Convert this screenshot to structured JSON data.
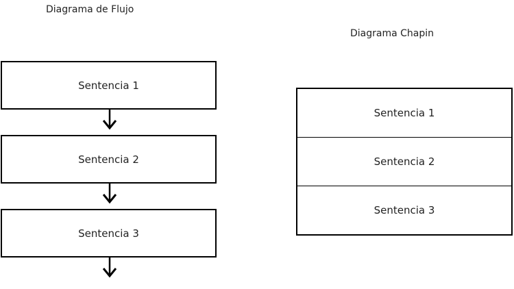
{
  "flow_diagram": {
    "title": "Diagrama de Flujo",
    "steps": [
      "Sentencia 1",
      "Sentencia 2",
      "Sentencia 3"
    ]
  },
  "chapin_diagram": {
    "title": "Diagrama Chapin",
    "rows": [
      "Sentencia 1",
      "Sentencia 2",
      "Sentencia 3"
    ]
  },
  "colors": {
    "line": "#000000",
    "background": "#ffffff",
    "text": "#222222"
  }
}
